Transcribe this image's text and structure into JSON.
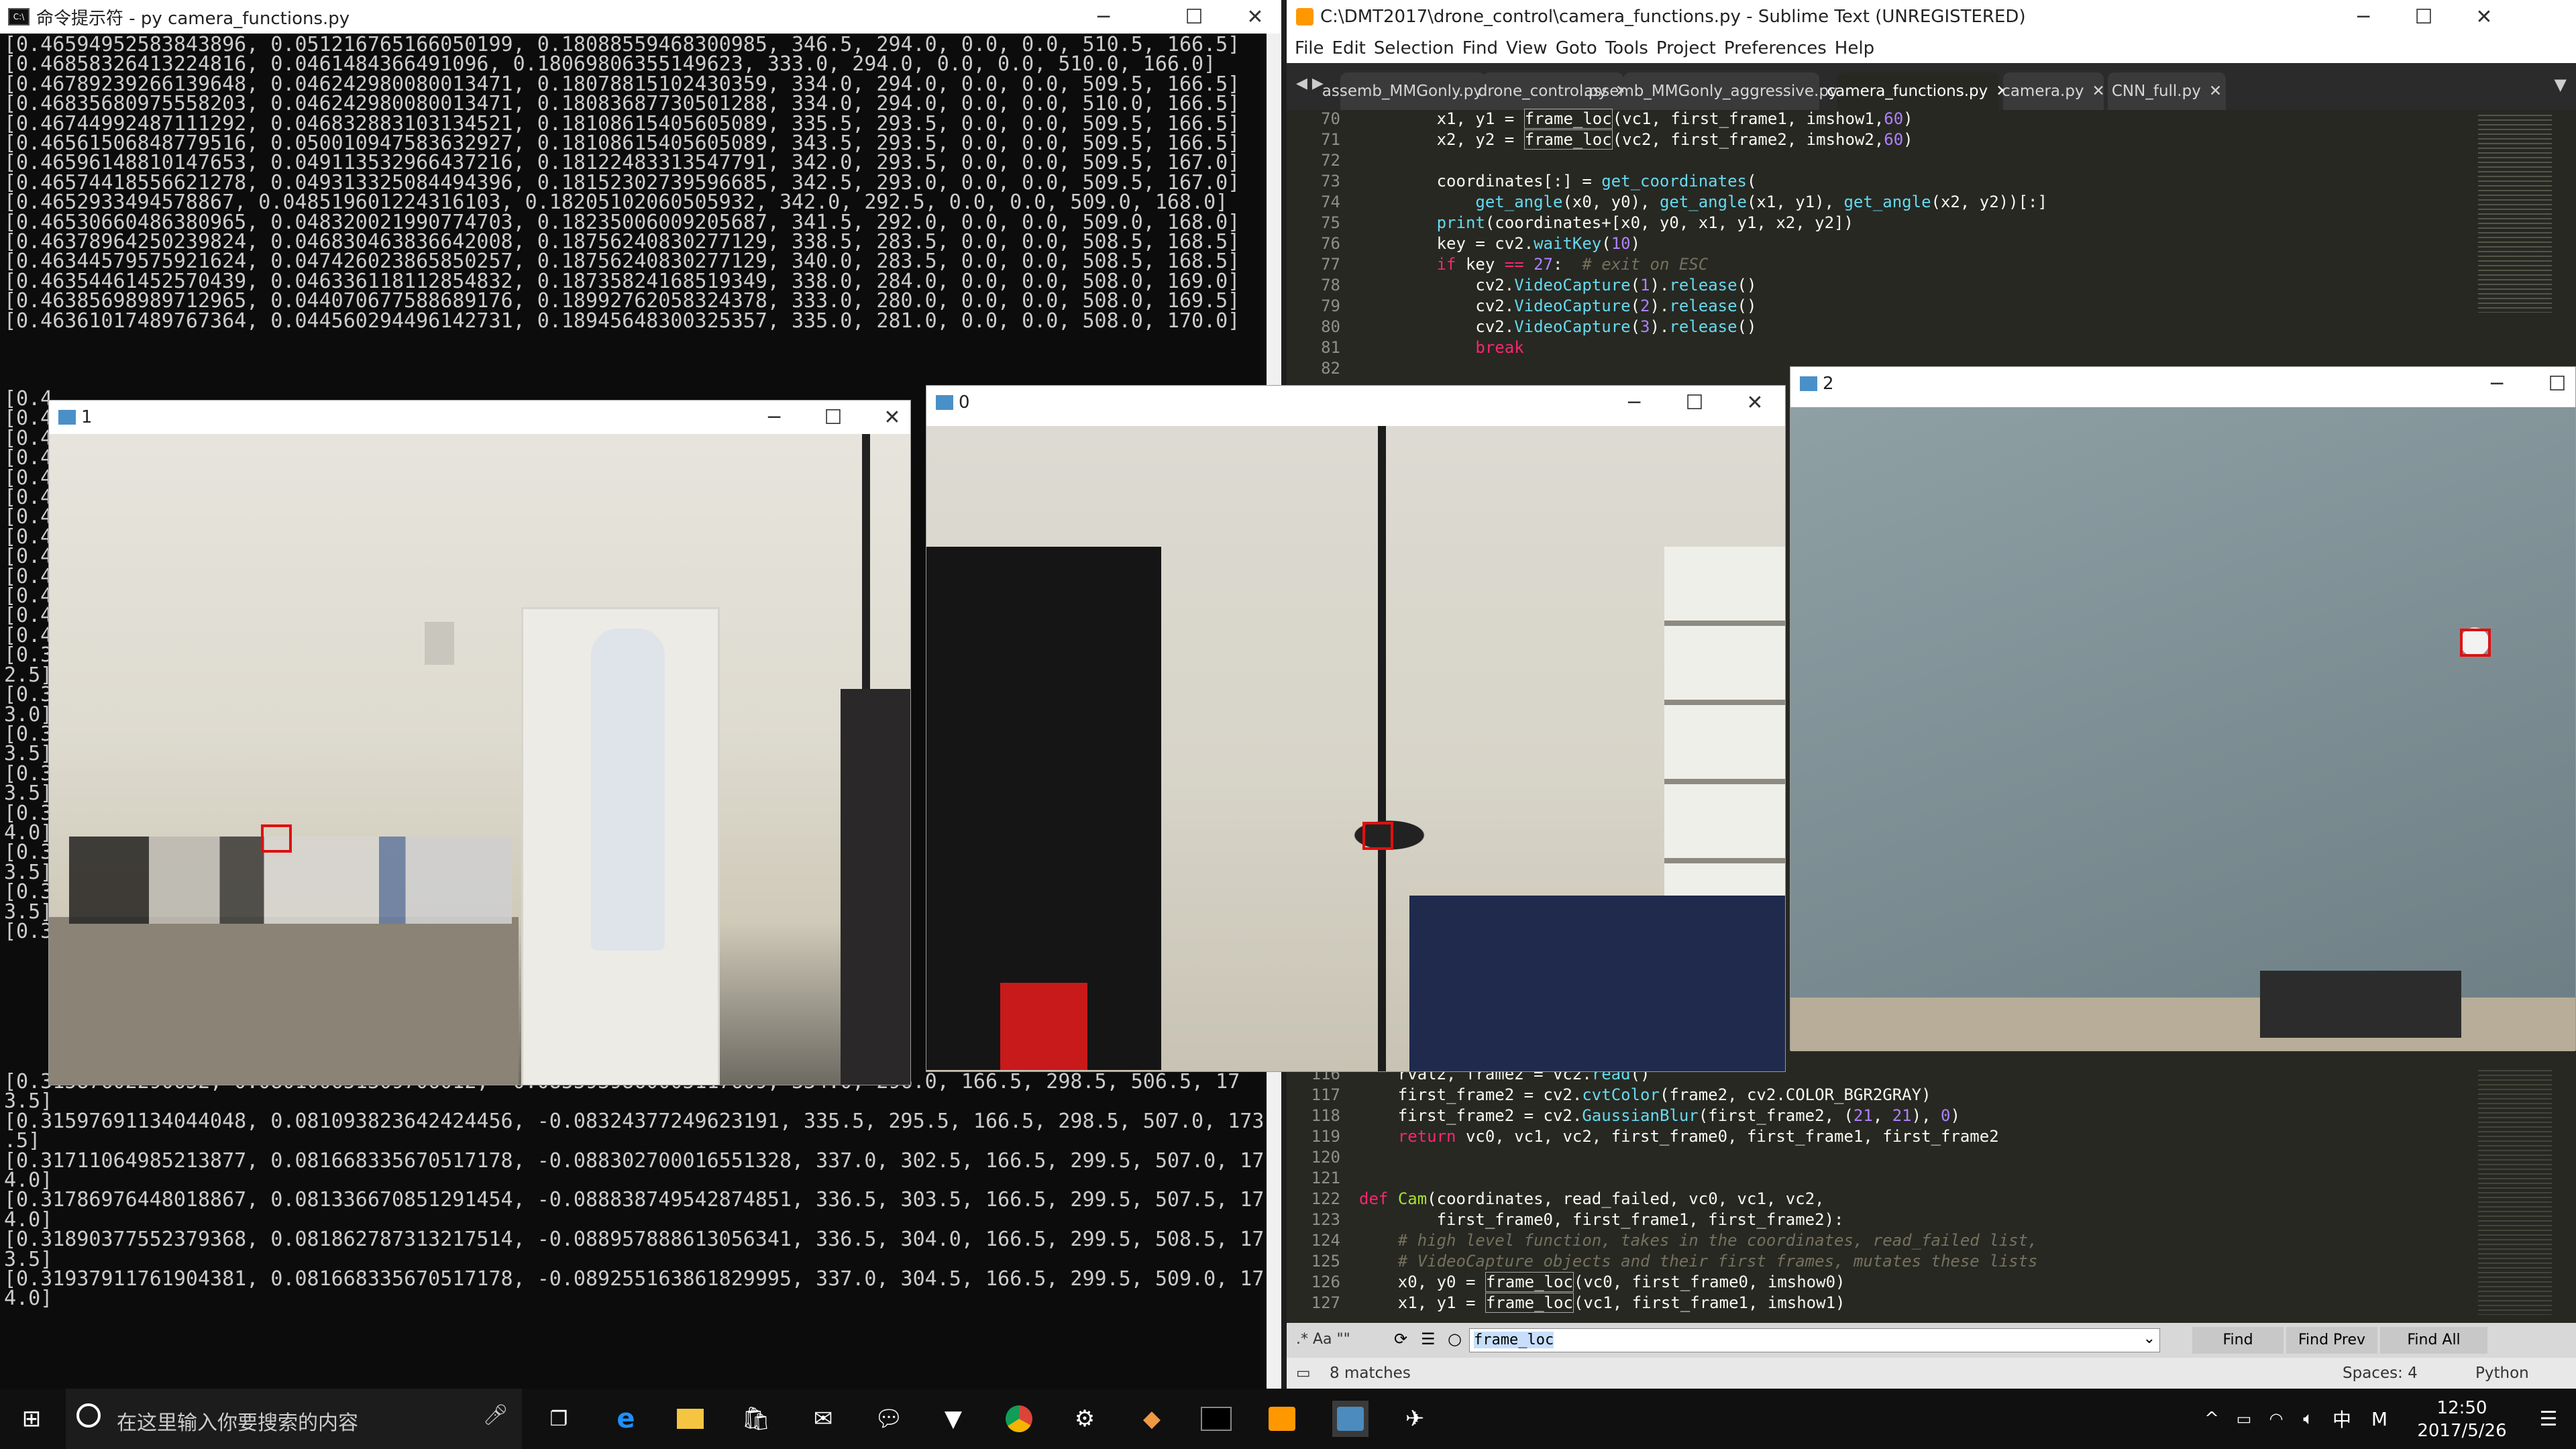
{
  "cmd": {
    "title": "命令提示符 - py  camera_functions.py",
    "top_lines": [
      "[0.46594952583843896, 0.051216765166050199, 0.18088559468300985, 346.5, 294.0, 0.0, 0.0, 510.5, 166.5]",
      "[0.46858326413224816, 0.0461484366491096, 0.18069806355149623, 333.0, 294.0, 0.0, 0.0, 510.0, 166.0]",
      "[0.46789239266139648, 0.046242980080013471, 0.18078815102430359, 334.0, 294.0, 0.0, 0.0, 509.5, 166.5]",
      "[0.46835680975558203, 0.046242980080013471, 0.18083687730501288, 334.0, 294.0, 0.0, 0.0, 510.0, 166.5]",
      "[0.46744992487111292, 0.046832883103134521, 0.18108615405605089, 335.5, 293.5, 0.0, 0.0, 509.5, 166.5]",
      "[0.46561506848779516, 0.050010947583632927, 0.18108615405605089, 343.5, 293.5, 0.0, 0.0, 509.5, 166.5]",
      "[0.46596148810147653, 0.049113532966437216, 0.18122483313547791, 342.0, 293.5, 0.0, 0.0, 509.5, 167.0]",
      "[0.46574418556621278, 0.049313325084494396, 0.18152302739596685, 342.5, 293.0, 0.0, 0.0, 509.5, 167.0]",
      "[0.4652933494578867, 0.048519601224316103, 0.18205102060505932, 342.0, 292.5, 0.0, 0.0, 509.0, 168.0]",
      "[0.46530660486380965, 0.048320021990774703, 0.18235006009205687, 341.5, 292.0, 0.0, 0.0, 509.0, 168.0]",
      "[0.46378964250239824, 0.046830463836642008, 0.18756240830277129, 338.5, 283.5, 0.0, 0.0, 508.5, 168.5]",
      "[0.46344579575921624, 0.047426023865850257, 0.18756240830277129, 340.0, 283.5, 0.0, 0.0, 508.5, 168.5]",
      "[0.46354461452570439, 0.046336118112854832, 0.18735824168519349, 338.0, 284.0, 0.0, 0.0, 508.0, 169.0]",
      "[0.46385698989712965, 0.044070677588689176, 0.18992762058324378, 333.0, 280.0, 0.0, 0.0, 508.0, 169.5]",
      "[0.46361017489767364, 0.044560294496142731, 0.18945648300325357, 335.0, 281.0, 0.0, 0.0, 508.0, 170.0]"
    ],
    "left_fragments": [
      "[0.4",
      "[0.4",
      "[0.4",
      "[0.4",
      "[0.4",
      "[0.4",
      "[0.4",
      "[0.4",
      "[0.4",
      "[0.4",
      "[0.4",
      "[0.4",
      "[0.4",
      "[0.3",
      "2.5]",
      "[0.3",
      "3.0]",
      "[0.3",
      "3.5]",
      "[0.3",
      "3.5]",
      "[0.3",
      "4.0]",
      "[0.3",
      "3.5]",
      "[0.3",
      "3.5]",
      "[0.3"
    ],
    "bottom_lines": [
      "[0.31587602290632, 0.080100651309706012, -0.0855939860005117609, 334.0, 296.0, 166.5, 298.5, 506.5, 17",
      "3.5]",
      "[0.31597691134044048, 0.081093823642424456, -0.08324377249623191, 335.5, 295.5, 166.5, 298.5, 507.0, 173",
      ".5]",
      "[0.31711064985213877, 0.081668335670517178, -0.088302700016551328, 337.0, 302.5, 166.5, 299.5, 507.0, 17",
      "4.0]",
      "[0.31786976448018867, 0.081336670851291454, -0.088838749542874851, 336.5, 303.5, 166.5, 299.5, 507.5, 17",
      "4.0]",
      "[0.31890377552379368, 0.081862787313217514, -0.088957888613056341, 336.5, 304.0, 166.5, 299.5, 508.5, 17",
      "3.5]",
      "[0.31937911761904381, 0.081668335670517178, -0.089255163861829995, 337.0, 304.5, 166.5, 299.5, 509.0, 17",
      "4.0]"
    ]
  },
  "sublime": {
    "title": "C:\\DMT2017\\drone_control\\camera_functions.py - Sublime Text (UNREGISTERED)",
    "menu": [
      "File",
      "Edit",
      "Selection",
      "Find",
      "View",
      "Goto",
      "Tools",
      "Project",
      "Preferences",
      "Help"
    ],
    "tabs": [
      "assemb_MMGonly.py",
      "drone_control.py",
      "assemb_MMGonly_aggressive.py",
      "camera_functions.py",
      "camera.py",
      "CNN_full.py"
    ],
    "active_tab": "camera_functions.py",
    "top_line_numbers": [
      "70",
      "71",
      "72",
      "73",
      "74",
      "75",
      "76",
      "77",
      "78",
      "79",
      "80",
      "81",
      "82"
    ],
    "bottom_line_numbers": [
      "116",
      "117",
      "118",
      "119",
      "120",
      "121",
      "122",
      "123",
      "124",
      "125",
      "126",
      "127"
    ],
    "find": {
      "value": "frame_loc",
      "find_label": "Find",
      "find_prev_label": "Find Prev",
      "find_all_label": "Find All",
      "options": ".*  Aa  \"\""
    },
    "status": {
      "matches": "8 matches",
      "spaces": "Spaces: 4",
      "syntax": "Python"
    }
  },
  "cams": {
    "cam1_title": "1",
    "cam0_title": "0",
    "cam2_title": "2"
  },
  "taskbar": {
    "search_placeholder": "在这里输入你要搜索的内容",
    "time": "12:50",
    "date": "2017/5/26",
    "ime": "中",
    "ime2": "M"
  }
}
